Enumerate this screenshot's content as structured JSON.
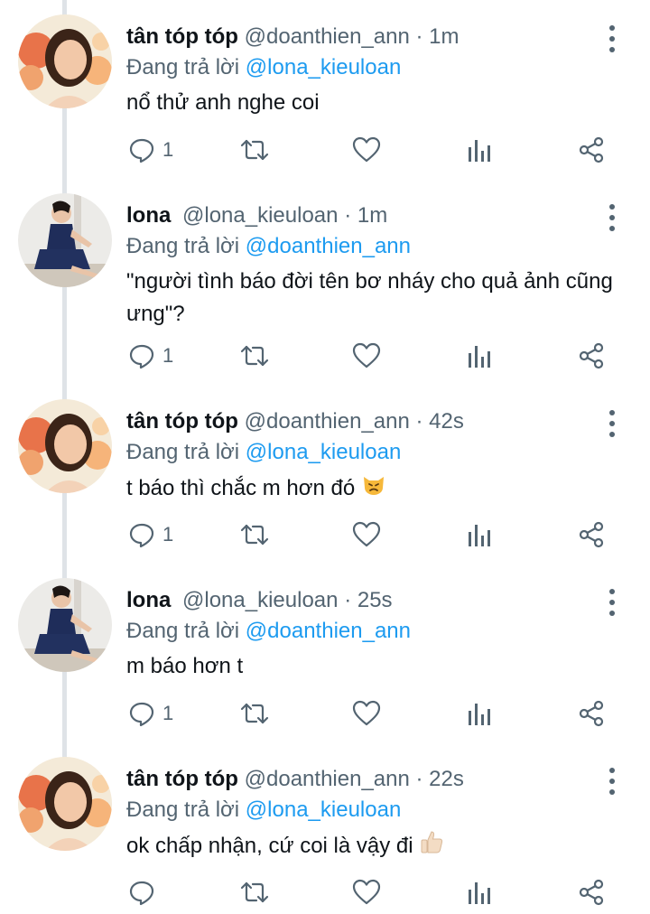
{
  "thread": {
    "tweets": [
      {
        "name": "tân tóp tóp",
        "handle": "@doanthien_ann",
        "time": "1m",
        "replying_prefix": "Đang trả lời",
        "replying_to": "@lona_kieuloan",
        "text": "nổ thử anh nghe coi",
        "reply_count": "1",
        "avatar": "avatar-flowers-woman"
      },
      {
        "name": "lona",
        "handle": "@lona_kieuloan",
        "time": "1m",
        "replying_prefix": "Đang trả lời",
        "replying_to": "@doanthien_ann",
        "text": "\"người tình báo đời tên bơ nháy cho quả ảnh cũng ưng\"?",
        "reply_count": "1",
        "avatar": "avatar-woman-dark-dress"
      },
      {
        "name": "tân tóp tóp",
        "handle": "@doanthien_ann",
        "time": "42s",
        "replying_prefix": "Đang trả lời",
        "replying_to": "@lona_kieuloan",
        "text": "t báo thì chắc m hơn đó",
        "emoji": "pouting-cat-emoji",
        "reply_count": "1",
        "avatar": "avatar-flowers-woman"
      },
      {
        "name": "lona",
        "handle": "@lona_kieuloan",
        "time": "25s",
        "replying_prefix": "Đang trả lời",
        "replying_to": "@doanthien_ann",
        "text": "m báo hơn t",
        "reply_count": "1",
        "avatar": "avatar-woman-dark-dress"
      },
      {
        "name": "tân tóp tóp",
        "handle": "@doanthien_ann",
        "time": "22s",
        "replying_prefix": "Đang trả lời",
        "replying_to": "@lona_kieuloan",
        "text": "ok chấp nhận, cứ coi là vậy đi",
        "emoji": "thumbs-up-emoji",
        "reply_count": "",
        "avatar": "avatar-flowers-woman"
      }
    ]
  },
  "colors": {
    "mention": "#1d9bf0",
    "secondary_text": "#536471",
    "primary_text": "#0f1419",
    "thread_line": "#dfe3e7"
  },
  "icons": [
    "reply-icon",
    "retweet-icon",
    "like-icon",
    "views-icon",
    "share-icon",
    "more-options-icon"
  ]
}
